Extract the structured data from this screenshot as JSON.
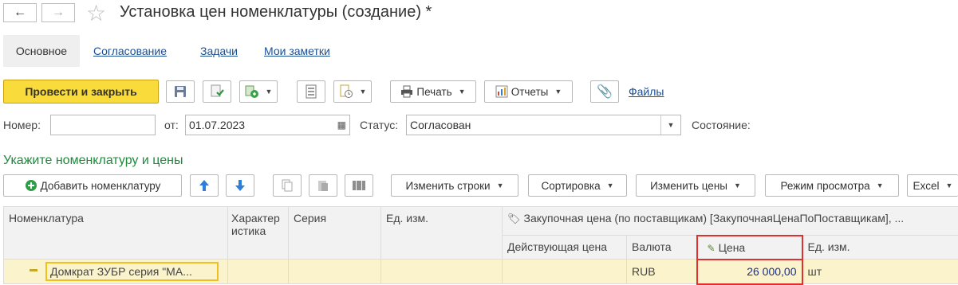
{
  "window": {
    "title": "Установка цен номенклатуры (создание) *",
    "star": "☆"
  },
  "nav": {
    "back": "←",
    "forward": "→"
  },
  "tabs": [
    "Основное",
    "Согласование",
    "Задачи",
    "Мои заметки"
  ],
  "toolbar": {
    "post_close": "Провести и закрыть",
    "print": "Печать",
    "reports": "Отчеты",
    "files": "Файлы"
  },
  "form": {
    "number_label": "Номер:",
    "number_value": "",
    "date_label": "от:",
    "date_value": "01.07.2023",
    "status_label": "Статус:",
    "status_value": "Согласован",
    "state_label": "Состояние:"
  },
  "section": {
    "title": "Укажите номенклатуру и цены"
  },
  "table_toolbar": {
    "add": "Добавить номенклатуру",
    "change_rows": "Изменить строки",
    "sort": "Сортировка",
    "change_prices": "Изменить цены",
    "view_mode": "Режим просмотра",
    "excel": "Excel"
  },
  "table": {
    "columns": {
      "nomenclature": "Номенклатура",
      "characteristic": "Характеристика",
      "series": "Серия",
      "unit": "Ед. изм.",
      "price_group": "Закупочная цена (по поставщикам) [ЗакупочнаяЦенаПоПоставщикам], ...",
      "current_price": "Действующая цена",
      "currency": "Валюта",
      "price": "Цена",
      "unit2": "Ед. изм."
    },
    "rows": [
      {
        "nomenclature": "Домкрат ЗУБР серия \"МА...",
        "characteristic": "",
        "series": "",
        "unit": "",
        "current_price": "",
        "currency": "RUB",
        "price": "26 000,00",
        "unit2": "шт"
      }
    ]
  }
}
